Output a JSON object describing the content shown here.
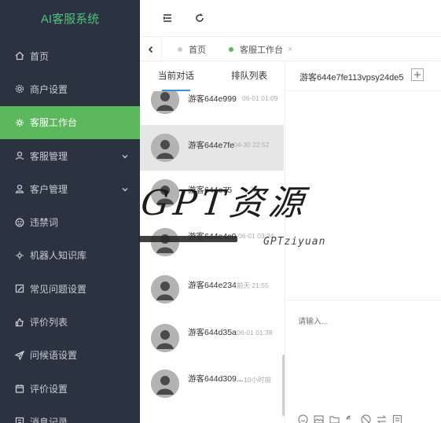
{
  "sidebar": {
    "brand": "AI客服系统",
    "items": [
      {
        "label": "首页",
        "icon": "home-icon"
      },
      {
        "label": "商户设置",
        "icon": "settings-icon"
      },
      {
        "label": "客服工作台",
        "icon": "workbench-icon",
        "active": true
      },
      {
        "label": "客服管理",
        "icon": "user-icon",
        "expandable": true
      },
      {
        "label": "客户管理",
        "icon": "customers-icon",
        "expandable": true
      },
      {
        "label": "违禁词",
        "icon": "smiley-icon"
      },
      {
        "label": "机器人知识库",
        "icon": "robot-icon"
      },
      {
        "label": "常见问题设置",
        "icon": "faq-icon"
      },
      {
        "label": "评价列表",
        "icon": "thumbs-up-icon"
      },
      {
        "label": "问候语设置",
        "icon": "send-icon"
      },
      {
        "label": "评价设置",
        "icon": "calendar-icon"
      },
      {
        "label": "消息记录",
        "icon": "record-icon"
      }
    ],
    "active_color": "#5cb85c",
    "bg_color": "#2b3340"
  },
  "topbar": {
    "menu_toggle_icon": "menu-fold-icon",
    "refresh_icon": "refresh-icon"
  },
  "tabs": [
    {
      "label": "首页",
      "active": false
    },
    {
      "label": "客服工作台",
      "active": true,
      "close": "×"
    }
  ],
  "conversation": {
    "tabs": [
      {
        "label": "当前对话",
        "active": true
      },
      {
        "label": "排队列表",
        "active": false
      }
    ],
    "items": [
      {
        "name": "游客644e999",
        "time": "06-01 01:09"
      },
      {
        "name": "游客644e7fe",
        "time": "04-30 22:52",
        "selected": true
      },
      {
        "name": "游客644e75",
        "time": "22:"
      },
      {
        "name": "游客644e4c0",
        "time": "06-01 03:24"
      },
      {
        "name": "游客644e234",
        "time": "前天 21:55"
      },
      {
        "name": "游客644d35a",
        "time": "06-01 01:38"
      },
      {
        "name": "游客644d309...",
        "time": "10小时前"
      }
    ]
  },
  "chat": {
    "title": "游客644e7fe113vpsy24de5",
    "input_placeholder": "请输入...",
    "tools": [
      "emoji-icon",
      "image-icon",
      "folder-icon",
      "voice-icon",
      "block-icon",
      "transfer-icon",
      "note-icon"
    ]
  },
  "watermark": {
    "main": "GPT资源",
    "sub": "GPTziyuan"
  },
  "accent_color": "#3f8fd8"
}
